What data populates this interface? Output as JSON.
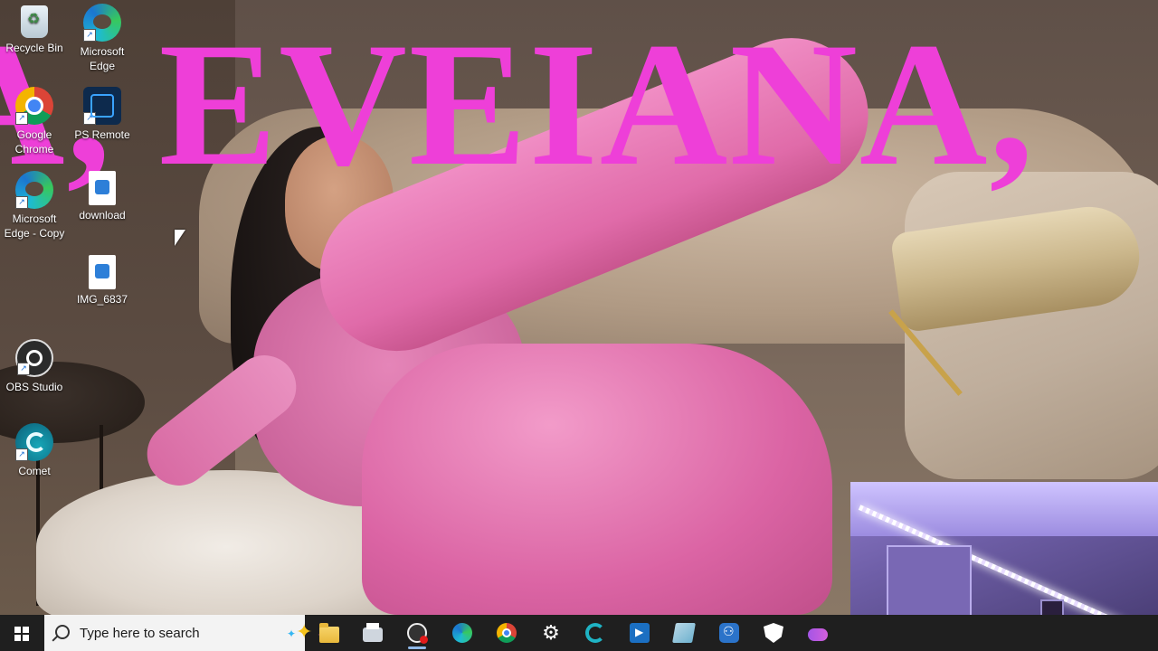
{
  "wallpaper": {
    "headline": "A, EVEIANA,",
    "headline_color": "#ee3fd8"
  },
  "desktop_icons": [
    {
      "label": "Recycle Bin",
      "icon": "recycle-bin-icon"
    },
    {
      "label": "Microsoft Edge",
      "icon": "edge-icon"
    },
    {
      "label": "Google Chrome",
      "icon": "chrome-icon"
    },
    {
      "label": "PS Remote",
      "icon": "ps-remote-icon"
    },
    {
      "label": "Microsoft Edge - Copy",
      "icon": "edge-icon"
    },
    {
      "label": "download",
      "icon": "image-file-icon"
    },
    {
      "label": "IMG_6837",
      "icon": "video-file-icon"
    },
    {
      "label": "OBS Studio",
      "icon": "obs-icon"
    },
    {
      "label": "Comet",
      "icon": "comet-icon"
    }
  ],
  "taskbar": {
    "search_placeholder": "Type here to search",
    "pinned": [
      {
        "name": "file-explorer-icon"
      },
      {
        "name": "printer-app-icon"
      },
      {
        "name": "obs-studio-icon",
        "active": true
      },
      {
        "name": "edge-icon"
      },
      {
        "name": "chrome-icon"
      },
      {
        "name": "settings-gear-icon"
      },
      {
        "name": "comet-icon"
      },
      {
        "name": "ps-remote-play-icon"
      },
      {
        "name": "notepad-icon"
      },
      {
        "name": "bot-app-icon"
      },
      {
        "name": "security-shield-icon"
      },
      {
        "name": "game-controller-icon"
      }
    ]
  }
}
